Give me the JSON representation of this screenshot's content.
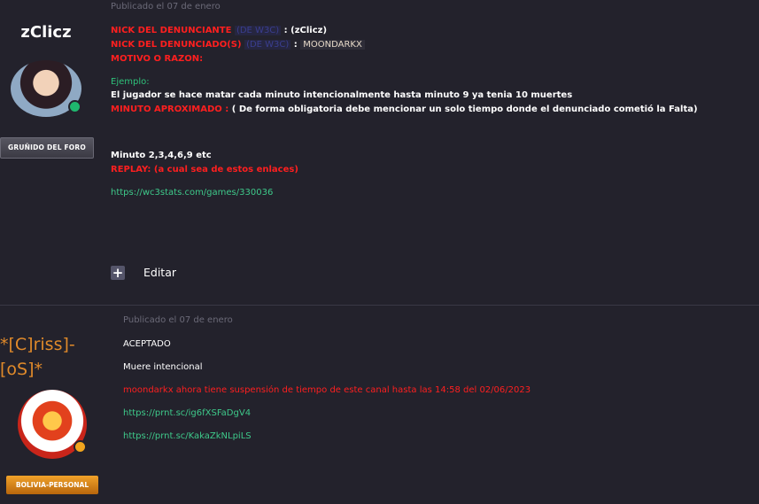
{
  "post1": {
    "author": "zClicz",
    "rank": "GRUÑIDO DEL FORO",
    "date": "Publicado el 07 de enero",
    "nick_denunciante_label": "NICK DEL DENUNCIANTE",
    "nick_denunciante_hint": "(DE W3C)",
    "nick_denunciante_value": ": (zClicz)",
    "nick_denunciado_label": "NICK DEL DENUNCIADO(S)",
    "nick_denunciado_hint": "(DE W3C)",
    "nick_denunciado_sep": ":",
    "nick_denunciado_value": "MOONDARKX",
    "motivo_label": "MOTIVO O RAZON:",
    "ejemplo_label": "Ejemplo:",
    "ejemplo_text": "El jugador se hace matar cada minuto intencionalmente hasta minuto 9 ya tenia 10 muertes",
    "minuto_label": "MINUTO APROXIMADO :",
    "minuto_text": "( De forma obligatoria debe mencionar un solo tiempo donde el denunciado cometió la Falta)",
    "minutos_value": "Minuto 2,3,4,6,9 etc",
    "replay_label": "REPLAY: (a cual sea de estos enlaces)",
    "replay_link": "https://wc3stats.com/games/330036",
    "edit_label": "Editar"
  },
  "post2": {
    "author_line1": "*[C]riss]-",
    "author_line2": "[oS]*",
    "rank": "BOLIVIA-PERSONAL",
    "date": "Publicado el 07 de enero",
    "status": "ACEPTADO",
    "reason": "Muere intencional",
    "sanction": "moondarkx ahora tiene suspensión de tiempo de este canal hasta las 14:58 del 02/06/2023",
    "link1": "https://prnt.sc/ig6fXSFaDgV4",
    "link2": "https://prnt.sc/KakaZkNLpiLS"
  }
}
